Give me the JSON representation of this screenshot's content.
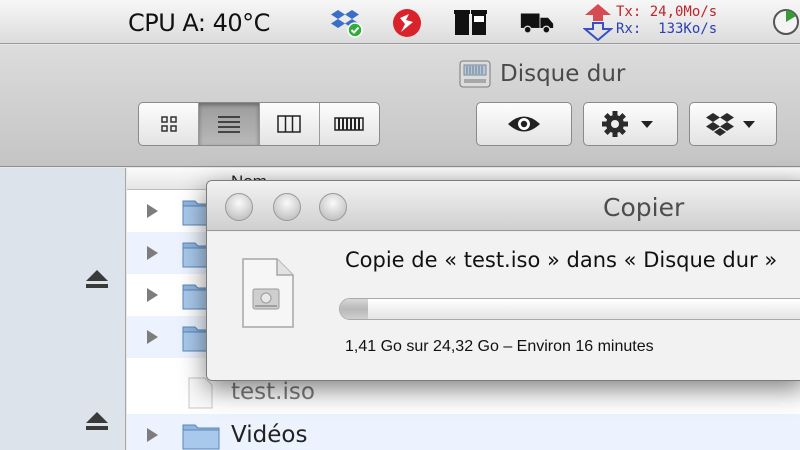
{
  "menubar": {
    "cpu_temp": "CPU A: 40°C",
    "icons": [
      "dropbox-sync-icon",
      "flash-icon",
      "trash-icons",
      "truck-icon"
    ],
    "network": {
      "tx": "Tx: 24,0Mo/s",
      "rx": "Rx:  133Ko/s",
      "tx_color": "#c0242b",
      "rx_color": "#2c3fb3"
    }
  },
  "window": {
    "title": "Disque dur",
    "title_icon": "hard-drive-icon"
  },
  "toolbar": {
    "view_modes": [
      "icon-view",
      "list-view",
      "column-view",
      "coverflow-view"
    ],
    "active_view": "list-view",
    "buttons": [
      "quick-look",
      "action-menu",
      "dropbox-menu"
    ]
  },
  "filelist": {
    "column_name": "Nom",
    "rows": [
      {
        "type": "folder",
        "name": ""
      },
      {
        "type": "folder",
        "name": ""
      },
      {
        "type": "folder",
        "name": ""
      },
      {
        "type": "folder",
        "name": ""
      },
      {
        "type": "file",
        "name": "test.iso"
      },
      {
        "type": "folder",
        "name": "Vidéos"
      }
    ]
  },
  "copy_dialog": {
    "title": "Copier",
    "message": "Copie de « test.iso » dans « Disque dur »",
    "status": "1,41 Go sur 24,32 Go – Environ 16 minutes",
    "progress": 0.058
  }
}
